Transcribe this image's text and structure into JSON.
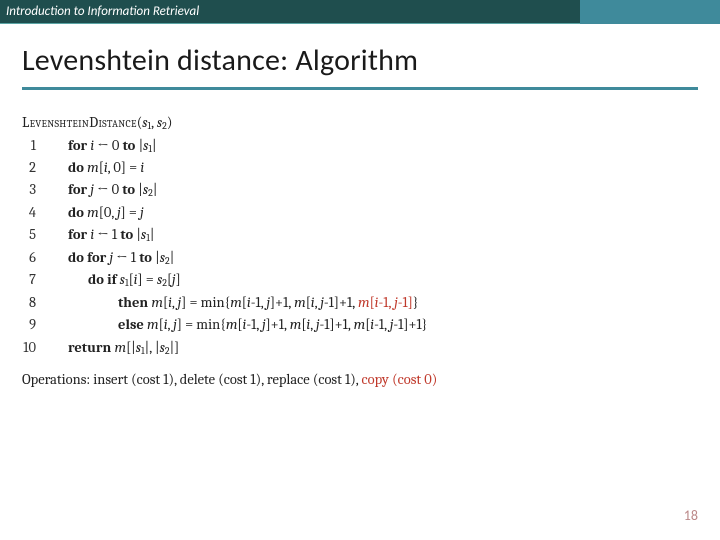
{
  "header": {
    "course": "Introduction to Information Retrieval"
  },
  "title": "Levenshtein distance: Algorithm",
  "algo": {
    "fn": "LevenshteinDistance",
    "args_html": "(<i>s</i><span class='sub'>1</span>, <i>s</i><span class='sub'>2</span>)",
    "lines": [
      {
        "n": "1",
        "ind": "i1",
        "html": "<span class='kw'>for</span> <i>i</i> ← 0 <span class='kw'>to</span> |<i>s</i><span class='sub'>1</span>|"
      },
      {
        "n": "2",
        "ind": "i1",
        "html": "<span class='kw'>do</span> <i>m</i>[<i>i</i>, 0] = <i>i</i>"
      },
      {
        "n": "3",
        "ind": "i1",
        "html": "<span class='kw'>for</span> <i>j</i> ← 0 <span class='kw'>to</span> |<i>s</i><span class='sub'>2</span>|"
      },
      {
        "n": "4",
        "ind": "i1",
        "html": "<span class='kw'>do</span> <i>m</i>[0, <i>j</i>] = <i>j</i>"
      },
      {
        "n": "5",
        "ind": "i1",
        "html": "<span class='kw'>for</span> <i>i</i> ← 1 <span class='kw'>to</span> |<i>s</i><span class='sub'>1</span>|"
      },
      {
        "n": "6",
        "ind": "i1",
        "html": "<span class='kw'>do for</span> <i>j</i> ← 1 <span class='kw'>to</span> |<i>s</i><span class='sub'>2</span>|"
      },
      {
        "n": "7",
        "ind": "i2",
        "html": "<span class='kw'>do if</span> <i>s</i><span class='sub'>1</span>[<i>i</i>] = <i>s</i><span class='sub'>2</span>[<i>j</i>]"
      },
      {
        "n": "8",
        "ind": "i3",
        "html": "<span class='kw'>then</span> <i>m</i>[<i>i</i>, <i>j</i>] = min{<i>m</i>[<i>i</i>-1, <i>j</i>]+1, <i>m</i>[<i>i</i>, <i>j</i>-1]+1, <span class='red'><i>m</i>[<i>i</i>-1, <i>j</i>-1]</span>}"
      },
      {
        "n": "9",
        "ind": "i3",
        "html": "<span class='kw'>else</span> <i>m</i>[<i>i</i>, <i>j</i>] = min{<i>m</i>[<i>i</i>-1, <i>j</i>]+1, <i>m</i>[<i>i</i>, <i>j</i>-1]+1, <i>m</i>[<i>i</i>-1, <i>j</i>-1]+1}"
      },
      {
        "n": "10",
        "ind": "i1",
        "html": "<span class='kw'>return</span> <i>m</i>[|<i>s</i><span class='sub'>1</span>|, |<i>s</i><span class='sub'>2</span>|]"
      }
    ]
  },
  "operations_html": "Operations: insert (cost 1), delete (cost 1), replace (cost 1), <span class='red'>copy (cost 0)</span>",
  "page": "18"
}
